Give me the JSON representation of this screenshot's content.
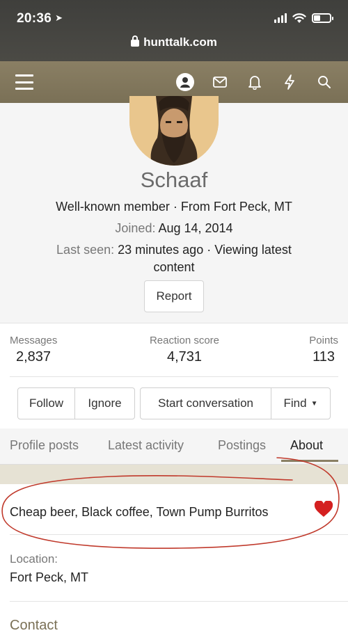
{
  "status_bar": {
    "time": "20:36"
  },
  "browser": {
    "url": "hunttalk.com"
  },
  "profile": {
    "username": "Schaaf",
    "title_line": "Well-known member · From Fort Peck, MT",
    "joined_label": "Joined:",
    "joined_value": "Aug 14, 2014",
    "last_seen_label": "Last seen:",
    "last_seen_value": "23 minutes ago · Viewing latest",
    "last_seen_value_2": "content",
    "report_label": "Report"
  },
  "stats": {
    "messages_label": "Messages",
    "messages_value": "2,837",
    "reaction_label": "Reaction score",
    "reaction_value": "4,731",
    "points_label": "Points",
    "points_value": "113"
  },
  "actions": {
    "follow": "Follow",
    "ignore": "Ignore",
    "start": "Start conversation",
    "find": "Find"
  },
  "tabs": [
    {
      "label": "Profile posts"
    },
    {
      "label": "Latest activity"
    },
    {
      "label": "Postings"
    },
    {
      "label": "About",
      "active": true
    }
  ],
  "about": {
    "text": "Cheap beer, Black coffee, Town Pump Burritos",
    "location_label": "Location:",
    "location_value": "Fort Peck, MT",
    "contact_label": "Contact"
  },
  "colors": {
    "nav": "#8a7f64",
    "heart": "#d42020",
    "annotation": "#c0392b"
  }
}
